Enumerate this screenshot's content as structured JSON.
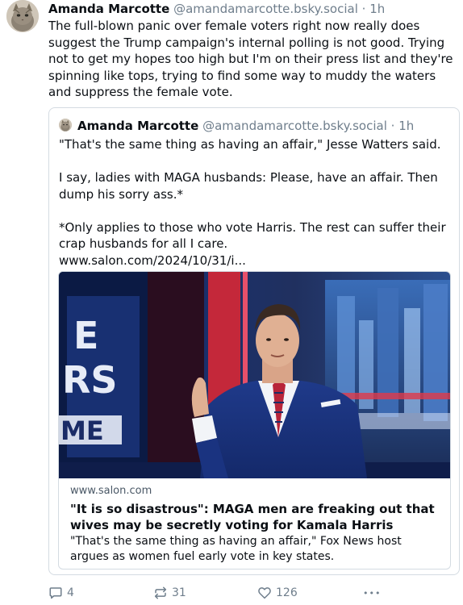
{
  "post": {
    "author_name": "Amanda Marcotte",
    "author_handle": "@amandamarcotte.bsky.social",
    "separator": "·",
    "time": "1h",
    "text": "The full-blown panic over female voters right now really does suggest the Trump campaign's internal polling is not good. Trying not to get my hopes too high but I'm on their press list and they're spinning like tops, trying to find some way to muddy the waters  and suppress the female vote."
  },
  "quote": {
    "author_name": "Amanda Marcotte",
    "author_handle": "@amandamarcotte.bsky.social",
    "separator": "·",
    "time": "1h",
    "paragraph1": "\"That's the same thing as having an affair,\" Jesse Watters said.",
    "paragraph2": "I say, ladies with MAGA husbands: Please, have an affair. Then dump his sorry ass.*",
    "paragraph3": "*Only applies to those who vote Harris. The rest can suffer their crap husbands for all I care.",
    "link": "www.salon.com/2024/10/31/i...",
    "card": {
      "domain": "www.salon.com",
      "title": "\"It is so disastrous\": MAGA men are freaking out that wives may be secretly voting for Kamala Harris",
      "description": "\"That's the same thing as having an affair,\" Fox News host argues as women fuel early vote in key states."
    }
  },
  "actions": {
    "replies": "4",
    "reposts": "31",
    "likes": "126",
    "more": "•••"
  },
  "colors": {
    "text": "#0b0f14",
    "muted": "#6f7e8c",
    "border": "#d4dbe2"
  }
}
